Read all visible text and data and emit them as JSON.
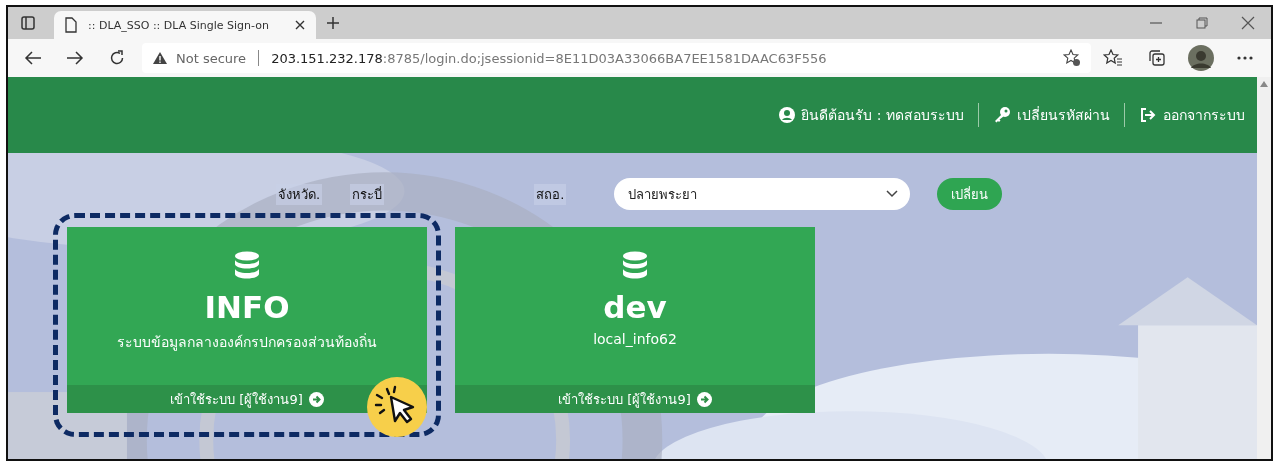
{
  "browser": {
    "tab_title": ":: DLA_SSO :: DLA Single Sign-on",
    "security": "Not secure",
    "url_host": "203.151.232.178",
    "url_path": ":8785/login.do;jsessionid=8E11D03A33066BA7EE1581DAAC63F556"
  },
  "header": {
    "welcome": "ยินดีต้อนรับ : ทดสอบระบบ",
    "change_password": "เปลี่ยนรหัสผ่าน",
    "logout": "ออกจากระบบ"
  },
  "filters": {
    "province_label": "จังหวัด.",
    "province": "กระบี่",
    "office_label": "สถอ.",
    "office_value": "ปลายพระยา",
    "change_button": "เปลี่ยน"
  },
  "cards": [
    {
      "title": "INFO",
      "subtitle": "ระบบข้อมูลกลางองค์กรปกครองส่วนท้องถิ่น",
      "action": "เข้าใช้ระบบ [ผู้ใช้งาน9]",
      "highlighted": true
    },
    {
      "title": "dev",
      "subtitle": "local_info62",
      "action": "เข้าใช้ระบบ [ผู้ใช้งาน9]",
      "highlighted": false
    }
  ]
}
